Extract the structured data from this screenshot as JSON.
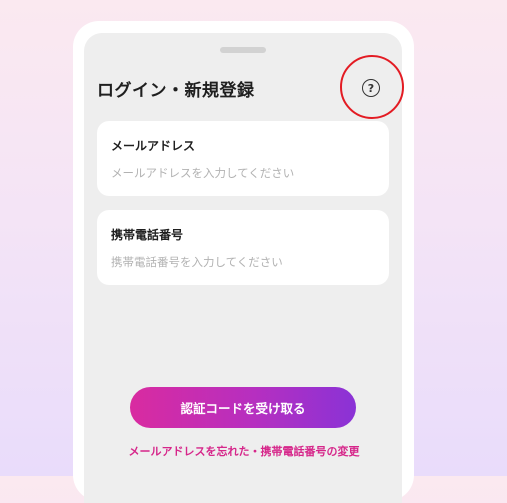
{
  "header": {
    "title": "ログイン・新規登録",
    "help_icon": "question-circle-icon",
    "help_glyph": "?"
  },
  "form": {
    "email": {
      "label": "メールアドレス",
      "placeholder": "メールアドレスを入力してください",
      "value": ""
    },
    "phone": {
      "label": "携帯電話番号",
      "placeholder": "携帯電話番号を入力してください",
      "value": ""
    }
  },
  "actions": {
    "submit_label": "認証コードを受け取る",
    "forgot_link": "メールアドレスを忘れた・携帯電話番号の変更"
  },
  "colors": {
    "accent_start": "#d92ba0",
    "accent_end": "#8a32d6",
    "link": "#d6268a",
    "highlight": "#e31b23"
  }
}
